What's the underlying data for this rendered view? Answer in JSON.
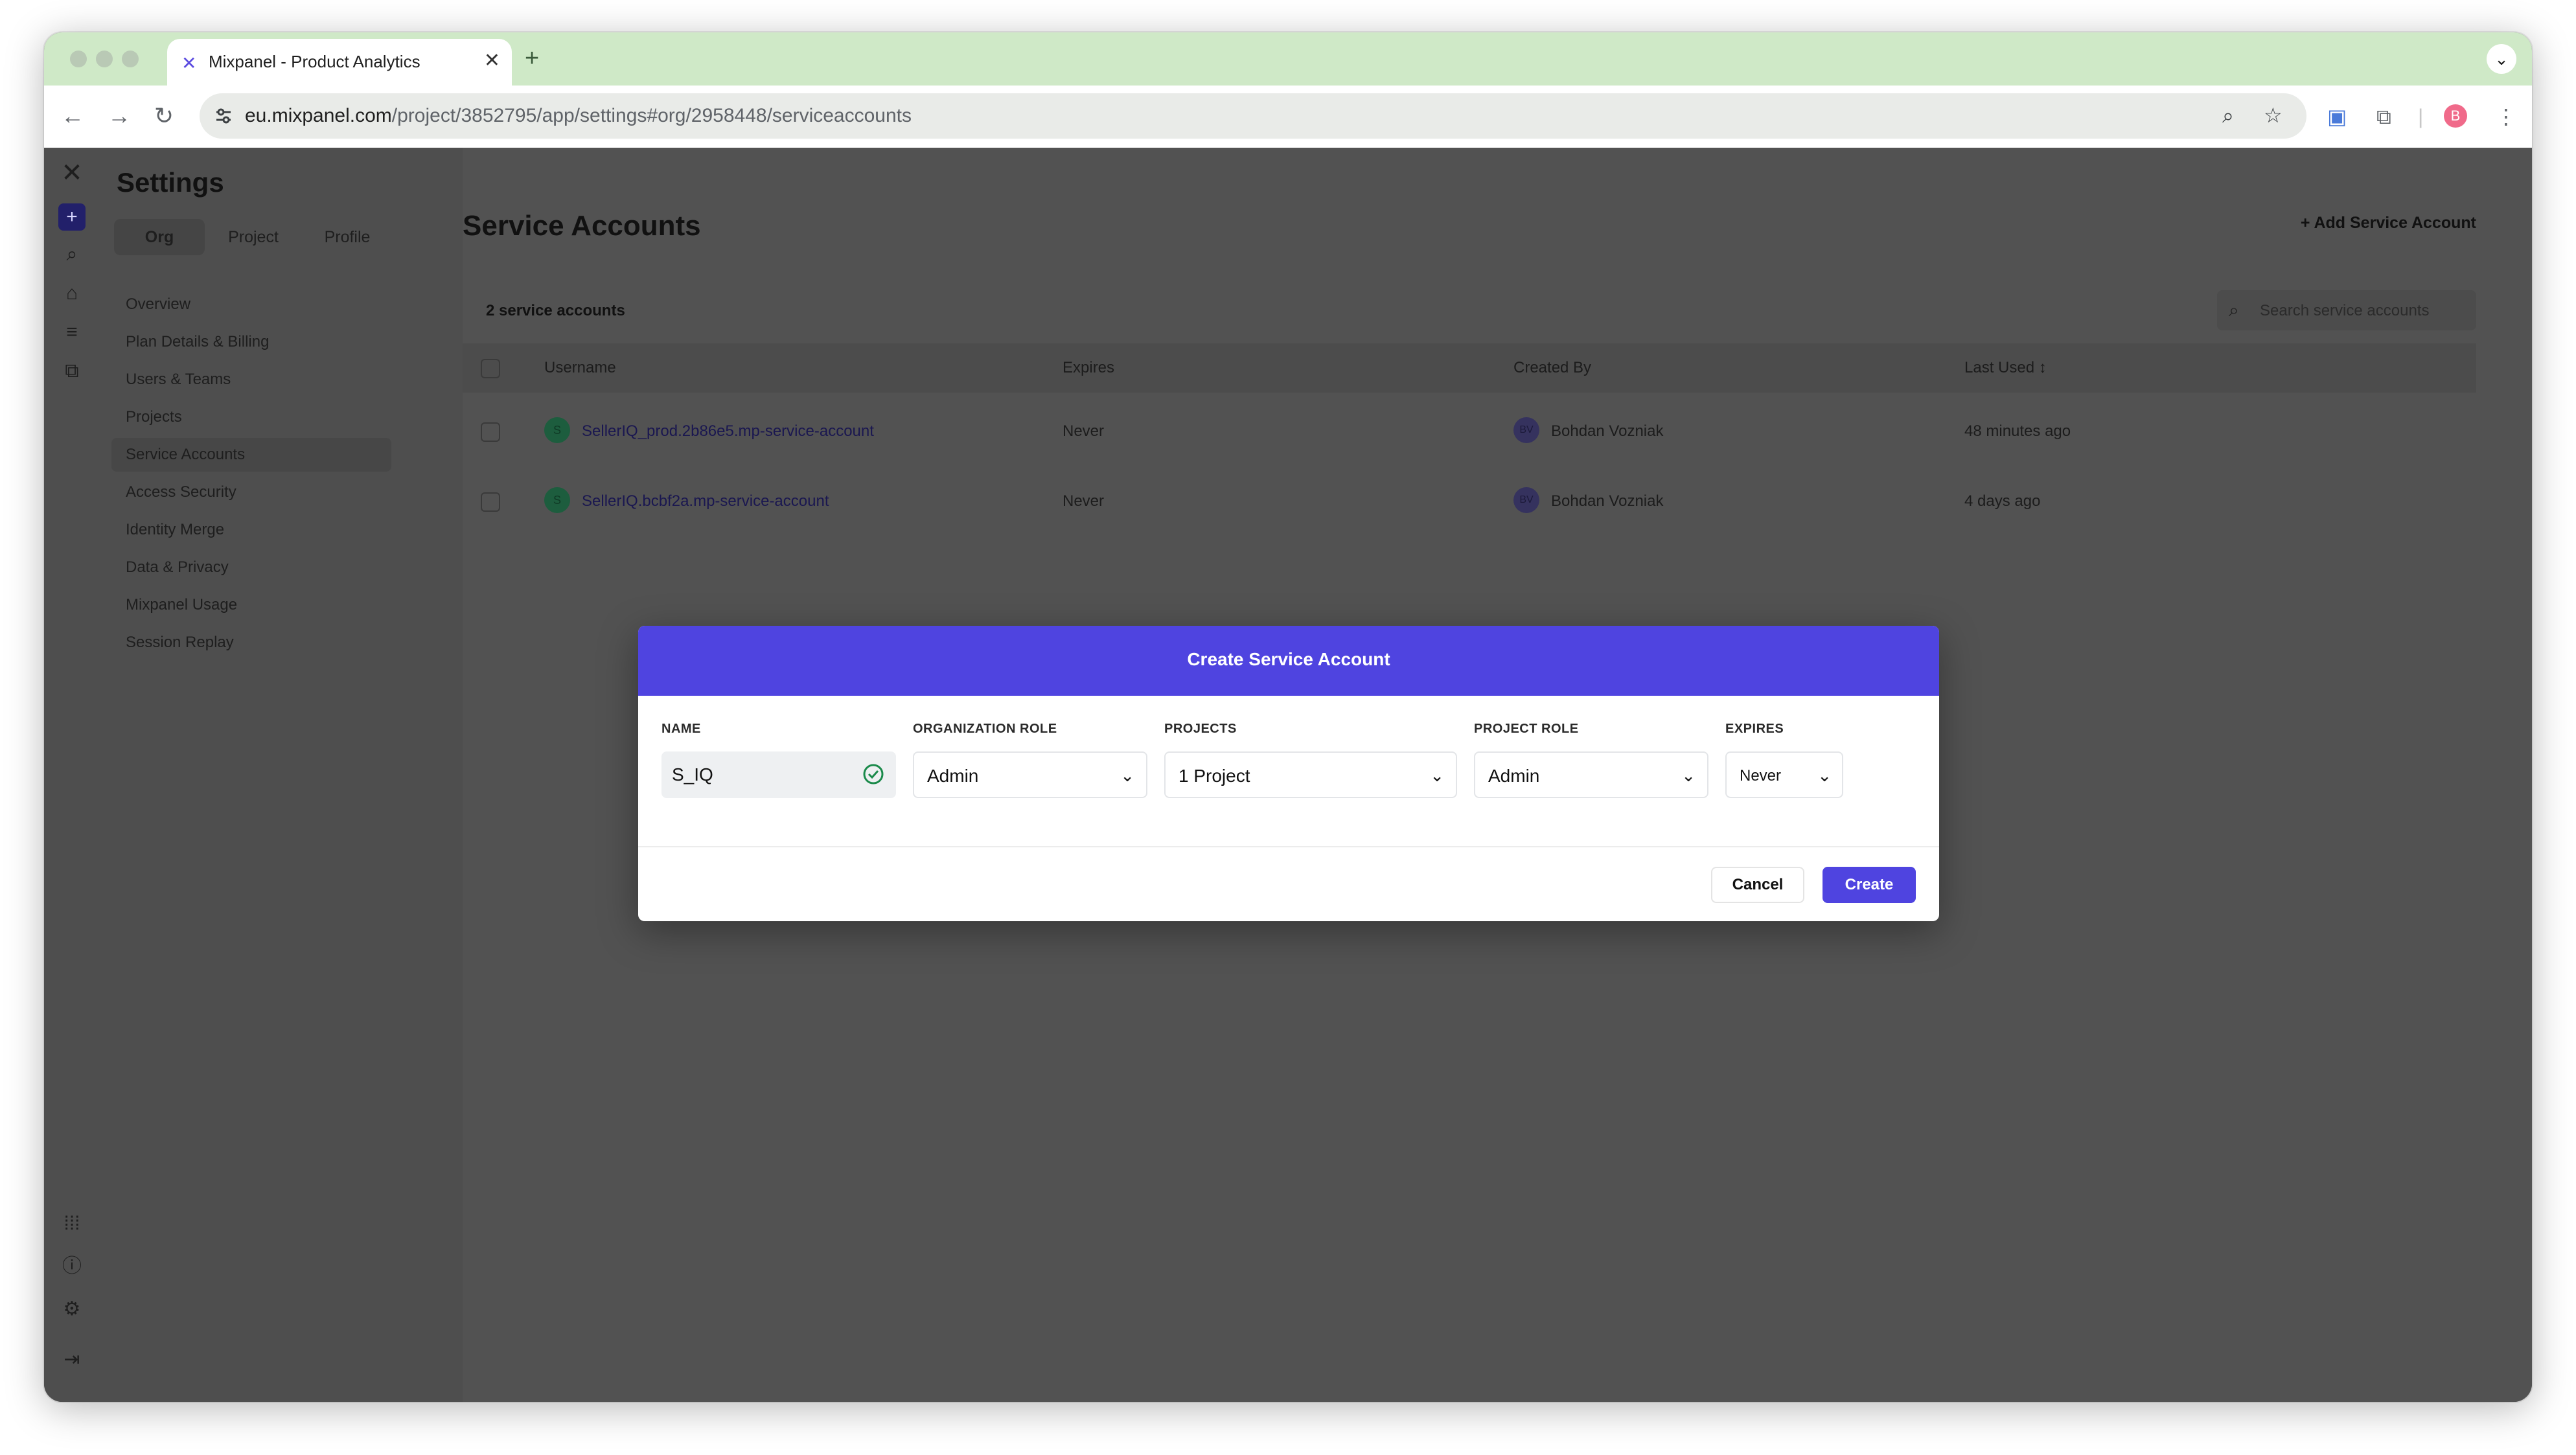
{
  "browser": {
    "tab_title": "Mixpanel - Product Analytics",
    "url_host": "eu.mixpanel.com",
    "url_path": "/project/3852795/app/settings#org/2958448/serviceaccounts",
    "profile_initial": "B"
  },
  "settings": {
    "title": "Settings",
    "scopes": [
      "Org",
      "Project",
      "Profile"
    ],
    "active_scope": "Org",
    "nav": [
      "Overview",
      "Plan Details & Billing",
      "Users & Teams",
      "Projects",
      "Service Accounts",
      "Access Security",
      "Identity Merge",
      "Data & Privacy",
      "Mixpanel Usage",
      "Session Replay"
    ],
    "active_nav": "Service Accounts"
  },
  "page": {
    "title": "Service Accounts",
    "add_button": "Add Service Account",
    "count_label": "2 service accounts",
    "search_placeholder": "Search service accounts"
  },
  "table": {
    "columns": [
      "Username",
      "Expires",
      "Created By",
      "Last Used"
    ],
    "rows": [
      {
        "avatar": "S",
        "username": "SellerIQ_prod.2b86e5.mp-service-account",
        "expires": "Never",
        "creator_initials": "BV",
        "created_by": "Bohdan Vozniak",
        "last_used": "48 minutes ago"
      },
      {
        "avatar": "S",
        "username": "SellerIQ.bcbf2a.mp-service-account",
        "expires": "Never",
        "creator_initials": "BV",
        "created_by": "Bohdan Vozniak",
        "last_used": "4 days ago"
      }
    ]
  },
  "modal": {
    "title": "Create Service Account",
    "labels": {
      "name": "NAME",
      "org_role": "ORGANIZATION ROLE",
      "projects": "PROJECTS",
      "project_role": "PROJECT ROLE",
      "expires": "EXPIRES"
    },
    "values": {
      "name": "S_IQ",
      "org_role": "Admin",
      "projects": "1 Project",
      "project_role": "Admin",
      "expires": "Never"
    },
    "cancel": "Cancel",
    "create": "Create"
  },
  "colors": {
    "accent": "#4f44e0",
    "chrome_tabstrip": "#cfe9c7",
    "overlay": "#525252",
    "valid_green": "#1a8a4a"
  }
}
